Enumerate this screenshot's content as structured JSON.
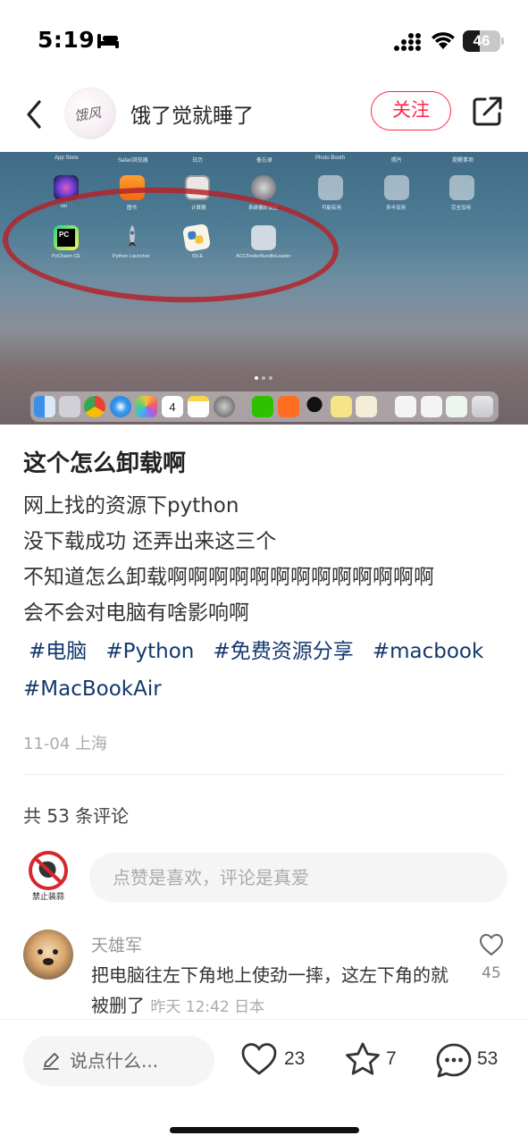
{
  "status_bar": {
    "time": "5:19",
    "battery_text": "46",
    "battery_level": 0.46,
    "icons": [
      "sleep-bed-icon",
      "cellular-signal-icon",
      "wifi-icon",
      "battery-icon"
    ]
  },
  "nav": {
    "author_name": "饿了觉就睡了",
    "avatar_text": "饿风",
    "follow_label": "关注",
    "icons": [
      "back-chevron-icon",
      "share-icon"
    ]
  },
  "post_image": {
    "menu_labels": [
      "App Store",
      "Safari浏览器",
      "日历",
      "备忘录",
      "Photo Booth",
      "照片",
      "提醒事项"
    ],
    "top_row_apps": [
      "siri",
      "图书",
      "计算器",
      "系统偏好设置",
      "可能有用",
      "多半没用",
      "完全没用"
    ],
    "circled_apps": [
      "PyCharm CE",
      "Python Launcher",
      "IDLE",
      "ACCFinderBundleLoader"
    ],
    "pycharm_badge": "PC",
    "calendar_day": "4",
    "annotation_color": "#b3242c"
  },
  "post": {
    "title": "这个怎么卸载啊",
    "lines": [
      "网上找的资源下python",
      "没下载成功 还弄出来这三个",
      "不知道怎么卸载啊啊啊啊啊啊啊啊啊啊啊啊啊",
      "会不会对电脑有啥影响啊"
    ],
    "tags": [
      "#电脑",
      "#Python",
      "#免费资源分享",
      "#macbook",
      "#MacBookAir"
    ],
    "meta": "11-04 上海"
  },
  "comments": {
    "count_label": "共 53 条评论",
    "my_avatar_label": "禁止装蒜",
    "input_placeholder": "点赞是喜欢，评论是真爱",
    "items": [
      {
        "name": "天雄军",
        "text": "把电脑往左下角地上使劲一摔，这左下角的就被删了",
        "time": "昨天 12:42 日本",
        "likes": "45"
      }
    ]
  },
  "bottom_bar": {
    "input_placeholder": "说点什么...",
    "likes": "23",
    "collects": "7",
    "comments": "53"
  },
  "colors": {
    "accent": "#ff2442",
    "tag": "#13386c"
  }
}
